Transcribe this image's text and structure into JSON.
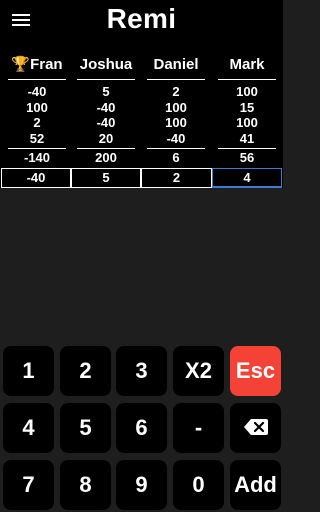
{
  "app": {
    "title": "Remi"
  },
  "board": {
    "players": [
      {
        "name": "Fran",
        "leader": true,
        "scores": [
          "-40",
          "100",
          "2",
          "52"
        ],
        "total": "-140",
        "entry": "-40"
      },
      {
        "name": "Joshua",
        "leader": false,
        "scores": [
          "5",
          "-40",
          "-40",
          "20"
        ],
        "total": "200",
        "entry": "5"
      },
      {
        "name": "Daniel",
        "leader": false,
        "scores": [
          "2",
          "100",
          "100",
          "-40"
        ],
        "total": "6",
        "entry": "2"
      },
      {
        "name": "Mark",
        "leader": false,
        "scores": [
          "100",
          "15",
          "100",
          "41"
        ],
        "total": "56",
        "entry": "4"
      }
    ],
    "leader_icon": "🏆",
    "active_entry_index": 3,
    "active_color": "#3d7bd9"
  },
  "keypad": {
    "keys": [
      {
        "label": "1"
      },
      {
        "label": "2"
      },
      {
        "label": "3"
      },
      {
        "label": "X2"
      },
      {
        "label": "Esc"
      },
      {
        "label": "4"
      },
      {
        "label": "5"
      },
      {
        "label": "6"
      },
      {
        "label": "-"
      },
      {
        "label": "",
        "icon": "backspace-icon"
      },
      {
        "label": "7"
      },
      {
        "label": "8"
      },
      {
        "label": "9"
      },
      {
        "label": "0"
      },
      {
        "label": "Add"
      }
    ],
    "esc_color": "#f44336"
  }
}
